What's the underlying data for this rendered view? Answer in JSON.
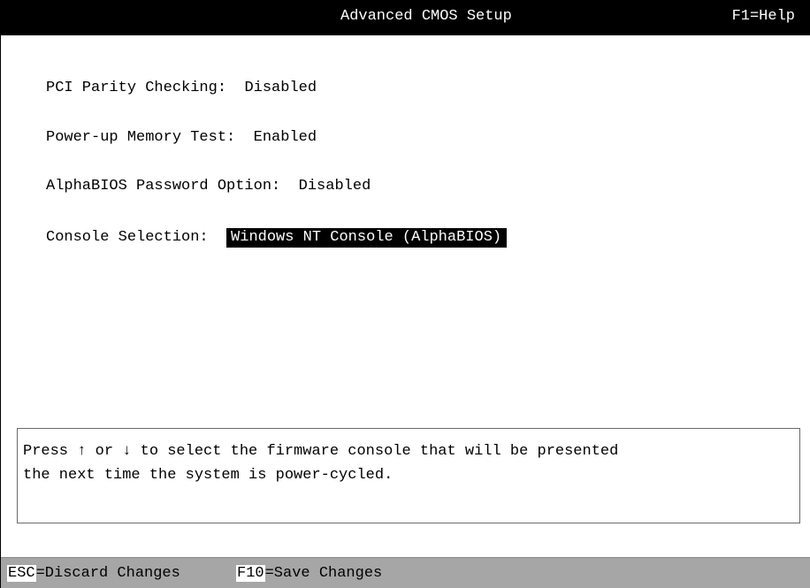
{
  "header": {
    "title": "Advanced CMOS Setup",
    "help": "F1=Help"
  },
  "settings": [
    {
      "label": "PCI Parity Checking:",
      "value": "Disabled",
      "selected": false
    },
    {
      "label": "Power-up Memory Test:",
      "value": "Enabled",
      "selected": false
    },
    {
      "label": "AlphaBIOS Password Option:",
      "value": "Disabled",
      "selected": false
    },
    {
      "label": "Console Selection:",
      "value": "Windows NT Console (AlphaBIOS)",
      "selected": true
    }
  ],
  "help_box": {
    "line1": "Press ↑ or ↓ to select the firmware console that will be presented",
    "line2": "the next time the system is power-cycled."
  },
  "status_bar": {
    "esc_key": "ESC",
    "esc_action": "=Discard Changes",
    "f10_key": "F10",
    "f10_action": "=Save Changes"
  },
  "colors": {
    "title_bar_bg": "#000000",
    "title_bar_fg": "#ffffff",
    "selection_bg": "#000000",
    "selection_fg": "#ffffff",
    "status_bar_bg": "#a6a6a6"
  }
}
